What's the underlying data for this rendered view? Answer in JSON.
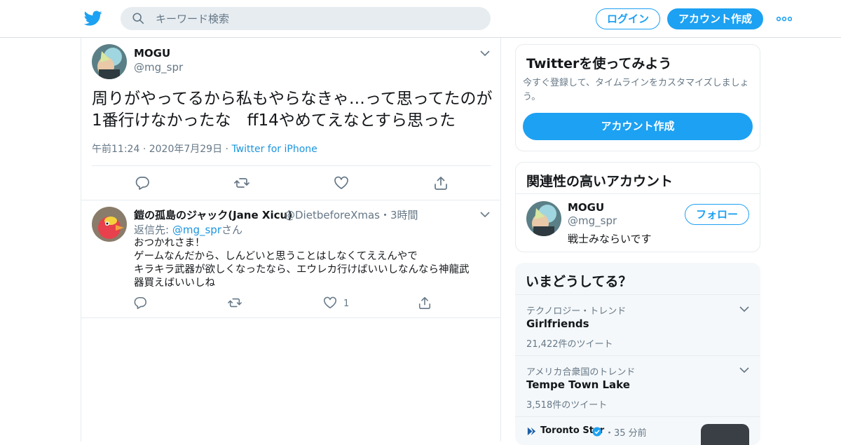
{
  "header": {
    "search_placeholder": "キーワード検索",
    "login_label": "ログイン",
    "signup_label": "アカウント作成"
  },
  "tweet": {
    "name": "MOGU",
    "handle": "@mg_spr",
    "text": "周りがやってるから私もやらなきゃ…って思ってたのが1番行けなかったな　ff14やめてえなとすら思った",
    "time": "午前11:24",
    "date": "2020年7月29日",
    "source": "Twitter for iPhone"
  },
  "reply": {
    "name": "鎧の孤島のジャック(Jane Xicu)",
    "handle_time": "@DietbeforeXmas・3時間",
    "reply_label": "返信先:",
    "reply_target": "@mg_spr",
    "reply_suffix": "さん",
    "lines": [
      "おつかれさま！",
      "ゲームなんだから、しんどいと思うことはしなくてええんやで",
      "キラキラ武器が欲しくなったなら、エウレカ行けばいいしなんなら神龍武",
      "器買えばいいしね"
    ],
    "like_count": "1"
  },
  "sidebar": {
    "signup_card": {
      "title": "Twitterを使ってみよう",
      "desc": "今すぐ登録して、タイムラインをカスタマイズしましょう。",
      "button": "アカウント作成"
    },
    "related": {
      "title": "関連性の高いアカウント",
      "name": "MOGU",
      "handle": "@mg_spr",
      "bio": "戦士みならいです",
      "follow": "フォロー"
    },
    "trends": {
      "title": "いまどうしてる？",
      "items": [
        {
          "context": "テクノロジー・トレンド",
          "name": "Girlfriends",
          "count": "21,422件のツイート"
        },
        {
          "context": "アメリカ合衆国のトレンド",
          "name": "Tempe Town Lake",
          "count": "3,518件のツイート"
        }
      ],
      "news_source": "Toronto Star",
      "news_time": "・35 分前"
    }
  },
  "colors": {
    "accent": "#1da1f2",
    "link": "#1b95e0",
    "muted": "#657786"
  }
}
